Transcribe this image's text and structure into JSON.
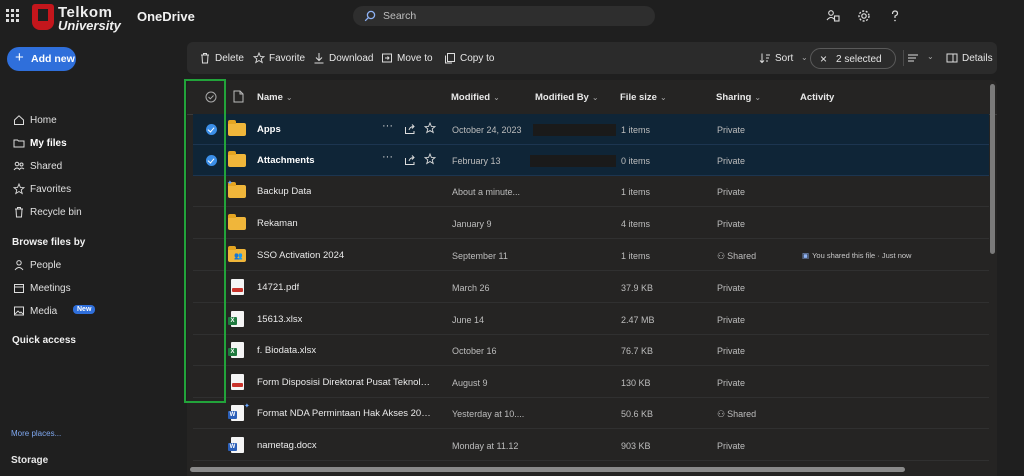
{
  "topbar": {
    "logo_line1": "Telkom",
    "logo_line2": "University",
    "app_title": "OneDrive",
    "search_placeholder": "Search"
  },
  "sidebar": {
    "add_new": "Add new",
    "items": [
      {
        "label": "Home",
        "icon": "home-icon"
      },
      {
        "label": "My files",
        "icon": "folder-icon",
        "active": true
      },
      {
        "label": "Shared",
        "icon": "people-icon"
      },
      {
        "label": "Favorites",
        "icon": "star-icon"
      },
      {
        "label": "Recycle bin",
        "icon": "trash-icon"
      }
    ],
    "browse_heading": "Browse files by",
    "browse_items": [
      {
        "label": "People",
        "icon": "person-icon"
      },
      {
        "label": "Meetings",
        "icon": "calendar-icon"
      },
      {
        "label": "Media",
        "icon": "image-icon",
        "badge": "New"
      }
    ],
    "quick_access": "Quick access",
    "more_places": "More places...",
    "storage": "Storage"
  },
  "commandbar": {
    "delete": "Delete",
    "favorite": "Favorite",
    "download": "Download",
    "move_to": "Move to",
    "copy_to": "Copy to",
    "sort": "Sort",
    "selected": "2 selected",
    "details": "Details"
  },
  "columns": {
    "name": "Name",
    "modified": "Modified",
    "modified_by": "Modified By",
    "file_size": "File size",
    "sharing": "Sharing",
    "activity": "Activity"
  },
  "files": [
    {
      "name": "Apps",
      "type": "folder",
      "modified": "October 24, 2023",
      "size": "1 items",
      "sharing": "Private",
      "selected": true
    },
    {
      "name": "Attachments",
      "type": "folder",
      "modified": "February 13",
      "size": "0 items",
      "sharing": "Private",
      "selected": true
    },
    {
      "name": "Backup Data",
      "type": "folder",
      "modified": "About a minute...",
      "size": "1 items",
      "sharing": "Private"
    },
    {
      "name": "Rekaman",
      "type": "folder",
      "modified": "January 9",
      "size": "4 items",
      "sharing": "Private"
    },
    {
      "name": "SSO Activation 2024",
      "type": "shared-folder",
      "modified": "September 11",
      "size": "1 items",
      "sharing": "Shared",
      "activity": "You shared this file · Just now"
    },
    {
      "name": "14721.pdf",
      "type": "pdf",
      "modified": "March 26",
      "size": "37.9 KB",
      "sharing": "Private"
    },
    {
      "name": "15613.xlsx",
      "type": "xlsx",
      "modified": "June 14",
      "size": "2.47 MB",
      "sharing": "Private"
    },
    {
      "name": "f. Biodata.xlsx",
      "type": "xlsx",
      "modified": "October 16",
      "size": "76.7 KB",
      "sharing": "Private"
    },
    {
      "name": "Form Disposisi Direktorat Pusat Teknologi ...",
      "type": "pdf",
      "modified": "August 9",
      "size": "130 KB",
      "sharing": "Private"
    },
    {
      "name": "Format NDA Permintaan Hak Akses 2024....",
      "type": "docx",
      "modified": "Yesterday at 10....",
      "size": "50.6 KB",
      "sharing": "Shared"
    },
    {
      "name": "nametag.docx",
      "type": "docx",
      "modified": "Monday at 11.12",
      "size": "903 KB",
      "sharing": "Private"
    }
  ],
  "colors": {
    "accent": "#2f6fdb",
    "selection": "#0f2537",
    "highlight_box": "#22a33a",
    "folder": "#f0b63a"
  }
}
